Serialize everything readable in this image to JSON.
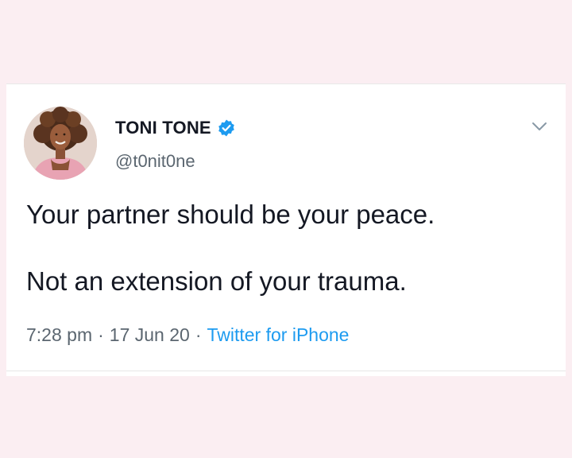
{
  "tweet": {
    "display_name": "TONI TONE",
    "handle": "@t0nit0ne",
    "verified": true,
    "text_lines": [
      "Your partner should be your peace.",
      "Not an extension of your trauma."
    ],
    "time": "7:28 pm",
    "date": "17 Jun 20",
    "separator": "·",
    "source": "Twitter for iPhone"
  },
  "icons": {
    "verified": "verified-badge-icon",
    "menu": "chevron-down-icon"
  },
  "colors": {
    "page_background": "#fbeef2",
    "card_background": "#ffffff",
    "text_primary": "#141823",
    "text_secondary": "#5b6670",
    "accent_blue": "#1d9bf0"
  }
}
